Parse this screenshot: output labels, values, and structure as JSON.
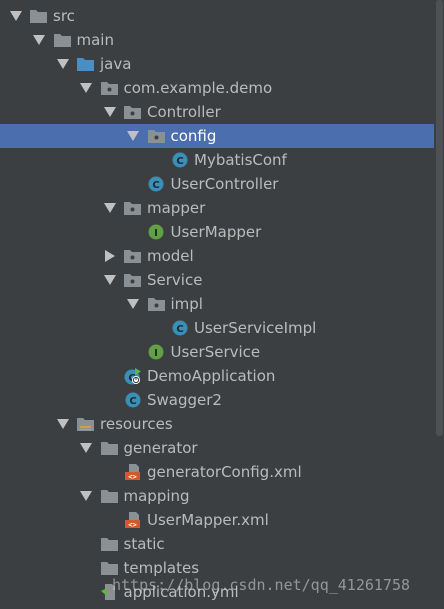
{
  "colors": {
    "background": "#3c3f41",
    "selection": "#4b6eaf",
    "text": "#bbbbbb",
    "folder": "#8b9094",
    "source_folder": "#4a8fc4",
    "class_icon": "#3a8fb7",
    "interface_icon": "#62a046",
    "xml_icon": "#d05a2c"
  },
  "tree": [
    {
      "depth": 0,
      "expanded": true,
      "icon": "folder-icon",
      "label": "src"
    },
    {
      "depth": 1,
      "expanded": true,
      "icon": "folder-icon",
      "label": "main"
    },
    {
      "depth": 2,
      "expanded": true,
      "icon": "source-folder-icon",
      "label": "java"
    },
    {
      "depth": 3,
      "expanded": true,
      "icon": "package-icon",
      "label": "com.example.demo"
    },
    {
      "depth": 4,
      "expanded": true,
      "icon": "package-icon",
      "label": "Controller"
    },
    {
      "depth": 5,
      "expanded": true,
      "icon": "package-icon",
      "label": "config",
      "selected": true
    },
    {
      "depth": 6,
      "expanded": null,
      "icon": "class-icon",
      "label": "MybatisConf"
    },
    {
      "depth": 5,
      "expanded": null,
      "icon": "class-icon",
      "label": "UserController"
    },
    {
      "depth": 4,
      "expanded": true,
      "icon": "package-icon",
      "label": "mapper"
    },
    {
      "depth": 5,
      "expanded": null,
      "icon": "interface-icon",
      "label": "UserMapper"
    },
    {
      "depth": 4,
      "expanded": false,
      "icon": "package-icon",
      "label": "model"
    },
    {
      "depth": 4,
      "expanded": true,
      "icon": "package-icon",
      "label": "Service"
    },
    {
      "depth": 5,
      "expanded": true,
      "icon": "package-icon",
      "label": "impl"
    },
    {
      "depth": 6,
      "expanded": null,
      "icon": "class-icon",
      "label": "UserServiceImpl"
    },
    {
      "depth": 5,
      "expanded": null,
      "icon": "interface-icon",
      "label": "UserService"
    },
    {
      "depth": 4,
      "expanded": null,
      "icon": "spring-boot-class-icon",
      "label": "DemoApplication"
    },
    {
      "depth": 4,
      "expanded": null,
      "icon": "class-icon",
      "label": "Swagger2"
    },
    {
      "depth": 2,
      "expanded": true,
      "icon": "resources-folder-icon",
      "label": "resources"
    },
    {
      "depth": 3,
      "expanded": true,
      "icon": "folder-icon",
      "label": "generator"
    },
    {
      "depth": 4,
      "expanded": null,
      "icon": "xml-file-icon",
      "label": "generatorConfig.xml"
    },
    {
      "depth": 3,
      "expanded": true,
      "icon": "folder-icon",
      "label": "mapping"
    },
    {
      "depth": 4,
      "expanded": null,
      "icon": "xml-file-icon",
      "label": "UserMapper.xml"
    },
    {
      "depth": 3,
      "expanded": null,
      "icon": "folder-icon",
      "label": "static"
    },
    {
      "depth": 3,
      "expanded": null,
      "icon": "folder-icon",
      "label": "templates"
    },
    {
      "depth": 3,
      "expanded": null,
      "icon": "yml-file-icon",
      "label": "application.yml"
    }
  ],
  "watermark": "https://blog.csdn.net/qq_41261758"
}
